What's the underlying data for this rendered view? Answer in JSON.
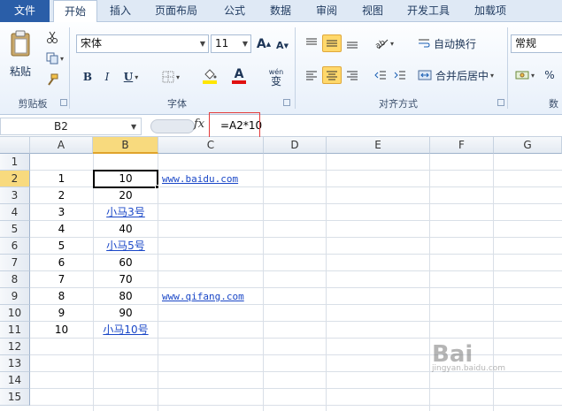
{
  "tabs": [
    {
      "label": "文件"
    },
    {
      "label": "开始"
    },
    {
      "label": "插入"
    },
    {
      "label": "页面布局"
    },
    {
      "label": "公式"
    },
    {
      "label": "数据"
    },
    {
      "label": "审阅"
    },
    {
      "label": "视图"
    },
    {
      "label": "开发工具"
    },
    {
      "label": "加载项"
    }
  ],
  "ribbon": {
    "clipboard": {
      "paste": "粘贴",
      "label": "剪贴板"
    },
    "font": {
      "name": "宋体",
      "size": "11",
      "bold": "B",
      "italic": "I",
      "underline": "U",
      "grow": "A",
      "shrink": "A",
      "font_color": "A",
      "phonetic": "wén",
      "phonetic_char": "变",
      "label": "字体",
      "fill_color": "#ffe600",
      "text_color": "#e01010"
    },
    "alignment": {
      "wrap": "自动换行",
      "merge": "合并后居中",
      "label": "对齐方式"
    },
    "number": {
      "format": "常规",
      "percent": "%",
      "label": "数"
    }
  },
  "formula_bar": {
    "name_box": "B2",
    "fx": "fx",
    "formula": "=A2*10"
  },
  "columns": [
    "A",
    "B",
    "C",
    "D",
    "E",
    "F",
    "G"
  ],
  "rows": [
    "1",
    "2",
    "3",
    "4",
    "5",
    "6",
    "7",
    "8",
    "9",
    "10",
    "11",
    "12",
    "13",
    "14",
    "15"
  ],
  "cells": {
    "A": [
      "",
      "1",
      "2",
      "3",
      "4",
      "5",
      "6",
      "7",
      "8",
      "9",
      "10"
    ],
    "B": [
      "",
      "10",
      "20",
      "小马3号",
      "40",
      "小马5号",
      "60",
      "70",
      "80",
      "90",
      "小马10号"
    ],
    "C2": "www.baidu.com",
    "C9": "www.qifang.com"
  },
  "watermark": {
    "brand": "Bai",
    "sub": "jingyan.baidu.com"
  }
}
